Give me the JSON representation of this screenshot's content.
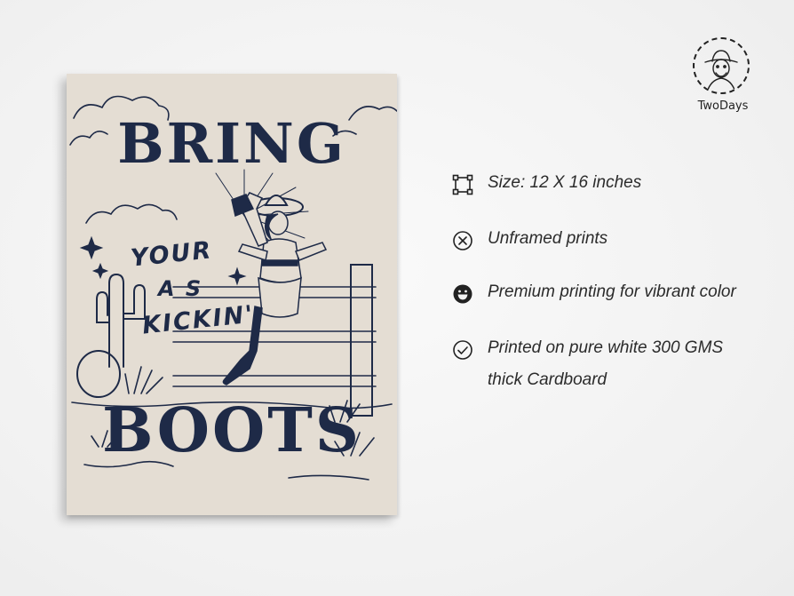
{
  "poster": {
    "line1": "BRING",
    "line2": "YOUR",
    "line3": "A  S",
    "line4": "KICKIN'",
    "line5": "BOOTS",
    "ink_color": "#1e2a47",
    "paper_color": "#e4ddd3"
  },
  "brand": {
    "name": "TwoDays"
  },
  "features": [
    {
      "icon": "frame-corners-icon",
      "text": "Size: 12 X 16 inches"
    },
    {
      "icon": "circle-x-icon",
      "text": "Unframed prints"
    },
    {
      "icon": "smiley-icon",
      "text": "Premium printing for vibrant color"
    },
    {
      "icon": "circle-check-icon",
      "text": "Printed on pure white 300 GMS thick Cardboard"
    }
  ]
}
